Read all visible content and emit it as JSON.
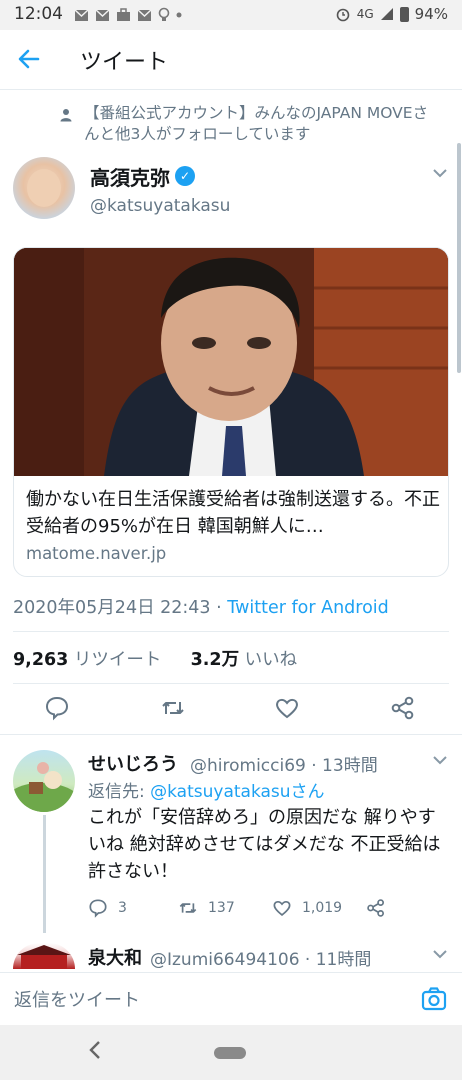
{
  "status_bar": {
    "time": "12:04",
    "network": "4G",
    "battery": "94%"
  },
  "header": {
    "title": "ツイート"
  },
  "tweet": {
    "social_context": "【番組公式アカウント】みんなのJAPAN MOVEさんと他3人がフォローしています",
    "author_name": "高須克弥",
    "author_handle": "@katsuyatakasu",
    "card": {
      "text": "働かない在日生活保護受給者は強制送還する。不正受給者の95%が在日 韓国朝鮮人に…",
      "domain": "matome.naver.jp"
    },
    "timestamp": "2020年05月24日 22:43",
    "separator": " · ",
    "client": "Twitter for Android",
    "retweets_count": "9,263",
    "retweets_label": " リツイート",
    "likes_count": "3.2万",
    "likes_label": " いいね"
  },
  "reply": {
    "author_name": "せいじろう",
    "meta": "@hiromicci69 · 13時間",
    "reply_to_prefix": "返信先: ",
    "reply_to_handle": "@katsuyatakasuさん",
    "text": "これが「安倍辞めろ」の原因だな 解りやすいね 絶対辞めさせてはダメだな 不正受給は許さない！",
    "reply_count": "3",
    "retweet_count": "137",
    "like_count": "1,019"
  },
  "reply2": {
    "author_name": "泉大和",
    "meta": "@Izumi66494106 · 11時間"
  },
  "compose": {
    "placeholder": "返信をツイート"
  }
}
